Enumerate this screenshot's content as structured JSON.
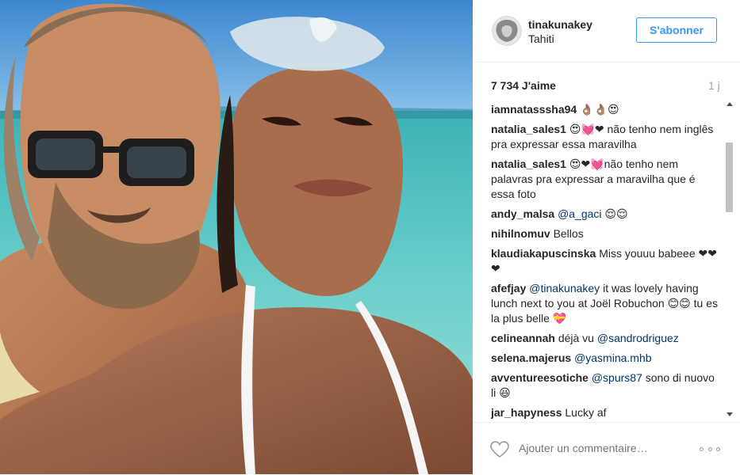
{
  "post": {
    "username": "tinakunakey",
    "location": "Tahiti",
    "follow_label": "S'abonner",
    "likes": "7 734 J'aime",
    "age": "1 j"
  },
  "comments": [
    {
      "author": "iamnatasssha94",
      "text": "👌🏽👌🏽😍"
    },
    {
      "author": "natalia_sales1",
      "text": "😍💓❤ não tenho nem inglês pra expressar essa maravilha"
    },
    {
      "author": "natalia_sales1",
      "text": "😍❤💓não tenho nem palavras pra expressar a maravilha que é essa foto"
    },
    {
      "author": "andy_malsa",
      "mention": "@a_gaci",
      "text": " 😌😌"
    },
    {
      "author": "nihilnomuv",
      "text": "Bellos"
    },
    {
      "author": "klaudiakapuscinska",
      "text": "Miss youuu babeee ❤❤❤"
    },
    {
      "author": "afefjay",
      "mention": "@tinakunakey",
      "text": " it was lovely having lunch next to you at Joël Robuchon 😊😊 tu es la plus belle 💝"
    },
    {
      "author": "celineannah",
      "prefix": "déjà vu ",
      "mention": "@sandrodriguez",
      "text": ""
    },
    {
      "author": "selena.majerus",
      "mention": "@yasmina.mhb",
      "text": ""
    },
    {
      "author": "avventureesotiche",
      "mention": "@spurs87",
      "text": " sono di nuovo li 😆"
    },
    {
      "author": "jar_hapyness",
      "text": "Lucky af"
    }
  ],
  "footer": {
    "comment_placeholder": "Ajouter un commentaire…"
  },
  "icons": {
    "like": "heart-icon",
    "more": "more-options-icon"
  },
  "colors": {
    "accent": "#3897f0",
    "mention": "#003569"
  }
}
